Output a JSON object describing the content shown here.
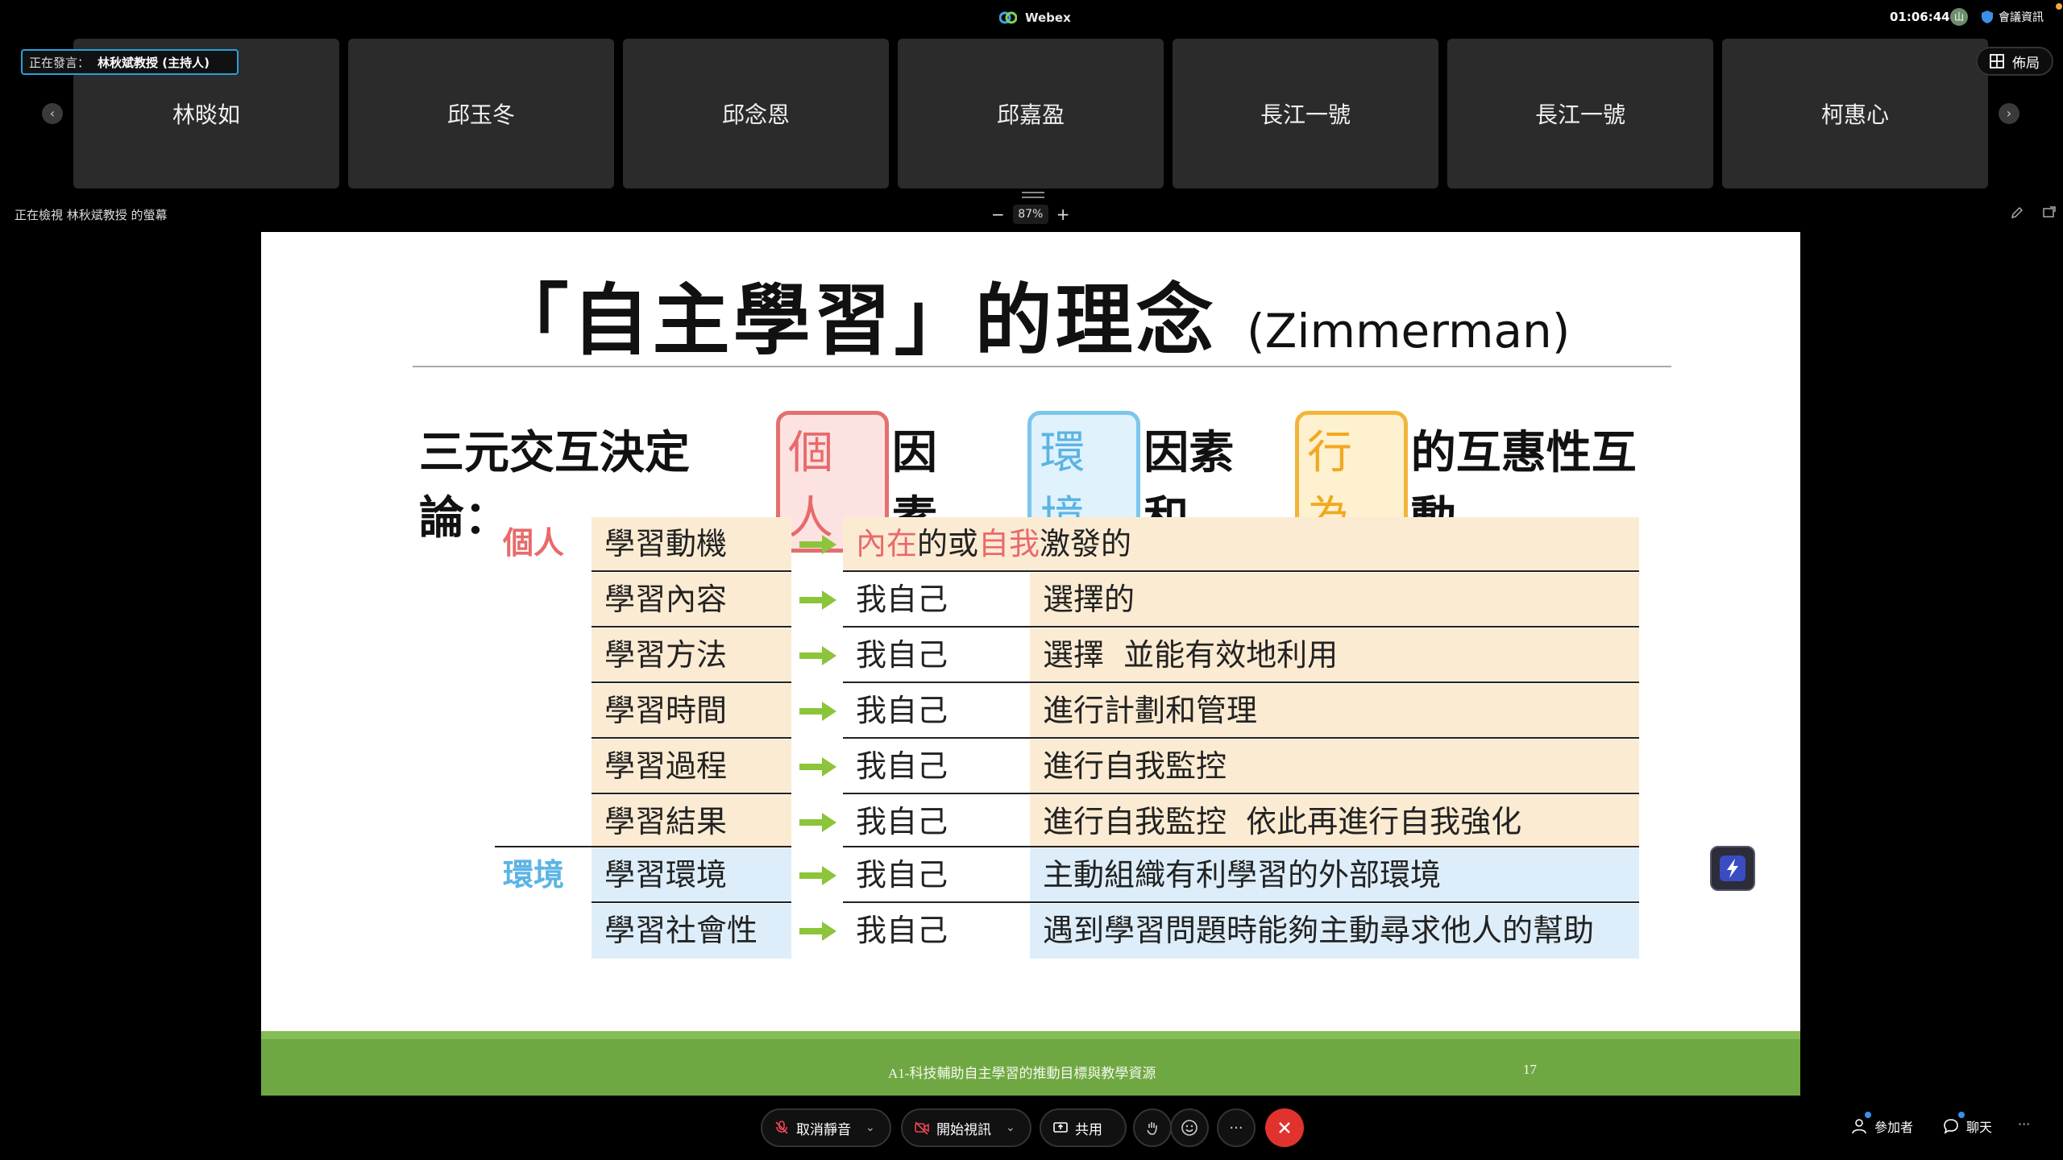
{
  "app": {
    "title": "Webex",
    "clock": "01:06:44",
    "avatar_initial": "山",
    "meeting_info": "會議資訊"
  },
  "speaking": {
    "label": "正在發言：",
    "name": "林秋斌教授 (主持人)"
  },
  "layout_button": {
    "label": "佈局"
  },
  "participants": [
    "林晱如",
    "邱玉冬",
    "邱念恩",
    "邱嘉盈",
    "長江一號",
    "長江一號",
    "柯惠心"
  ],
  "share": {
    "viewing_text": "正在檢視 林秋斌教授 的螢幕",
    "zoom_minus": "−",
    "zoom_value": "87%",
    "zoom_plus": "+"
  },
  "slide": {
    "title_main": "「自主學習」的理念",
    "title_eng": "(Zimmerman)",
    "subtitle_prefix": "三元交互決定論：",
    "subtitle_box1": "個人",
    "subtitle_mid1": "因素、",
    "subtitle_box2": "環境",
    "subtitle_mid2": "因素 和",
    "subtitle_box3": "行為",
    "subtitle_suffix": "的互惠性互動",
    "group_personal": "個人",
    "group_environment": "環境",
    "row1": {
      "item": "學習動機",
      "hl1": "內在",
      "t1": "的或",
      "hl2": "自我",
      "t2": "激發的"
    },
    "rows": [
      {
        "item": "學習內容",
        "who": "我自己",
        "what": "選擇的"
      },
      {
        "item": "學習方法",
        "who": "我自己",
        "what": "選擇  並能有效地利用"
      },
      {
        "item": "學習時間",
        "who": "我自己",
        "what": "進行計劃和管理"
      },
      {
        "item": "學習過程",
        "who": "我自己",
        "what": "進行自我監控"
      },
      {
        "item": "學習結果",
        "who": "我自己",
        "what": "進行自我監控  依此再進行自我強化"
      },
      {
        "item": "學習環境",
        "who": "我自己",
        "what": "主動組織有利學習的外部環境"
      },
      {
        "item": "學習社會性",
        "who": "我自己",
        "what": "遇到學習問題時能夠主動尋求他人的幫助"
      }
    ],
    "footer_text": "A1-科技輔助自主學習的推動目標與教學資源",
    "page_number": "17"
  },
  "controls": {
    "mute_label": "取消靜音",
    "video_label": "開始視訊",
    "share_label": "共用",
    "more_label": "···",
    "participants_label": "參加者",
    "chat_label": "聊天",
    "overflow_label": "···"
  },
  "colors": {
    "accent": "#2aa0d8",
    "end_call": "#e0332e",
    "slide_footer": "#6fa842",
    "personal": "#e86a6a",
    "environment": "#5bb4e4",
    "behavior": "#f2a81e",
    "tan_cell": "#fbebd2",
    "blue_cell": "#ddeefa",
    "arrow_green": "#8cc43a"
  },
  "icons": [
    "webex-logo-icon",
    "shield-icon",
    "grid-layout-icon",
    "chevron-left-icon",
    "chevron-right-icon",
    "mic-off-icon",
    "video-off-icon",
    "share-screen-icon",
    "raise-hand-icon",
    "reaction-icon",
    "close-icon",
    "person-icon",
    "chat-icon",
    "annotate-icon",
    "popout-icon",
    "lightning-icon"
  ]
}
